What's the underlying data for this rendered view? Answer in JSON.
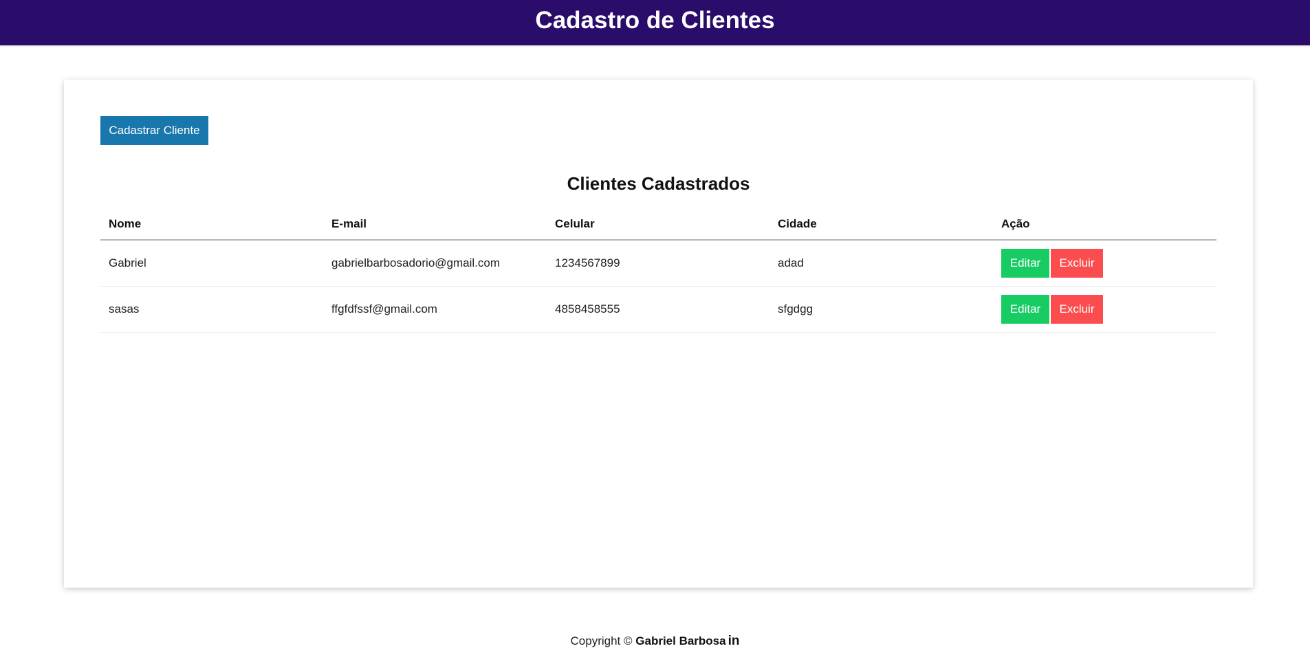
{
  "header": {
    "title": "Cadastro de Clientes",
    "background": "#2a0c6b"
  },
  "actions": {
    "add_label": "Cadastrar Cliente"
  },
  "table": {
    "title": "Clientes Cadastrados",
    "columns": [
      "Nome",
      "E-mail",
      "Celular",
      "Cidade",
      "Ação"
    ],
    "rows": [
      {
        "nome": "Gabriel",
        "email": "gabrielbarbosadorio@gmail.com",
        "celular": "1234567899",
        "cidade": "adad",
        "edit_label": "Editar",
        "delete_label": "Excluir"
      },
      {
        "nome": "sasas",
        "email": "ffgfdfssf@gmail.com",
        "celular": "4858458555",
        "cidade": "sfgdgg",
        "edit_label": "Editar",
        "delete_label": "Excluir"
      }
    ]
  },
  "footer": {
    "copyright": "Copyright ©",
    "author": "Gabriel Barbosa",
    "icon": "linkedin-icon",
    "icon_text": "in"
  },
  "colors": {
    "add_button": "#1877ac",
    "edit_button": "#16cc63",
    "delete_button": "#fb4d4f"
  }
}
